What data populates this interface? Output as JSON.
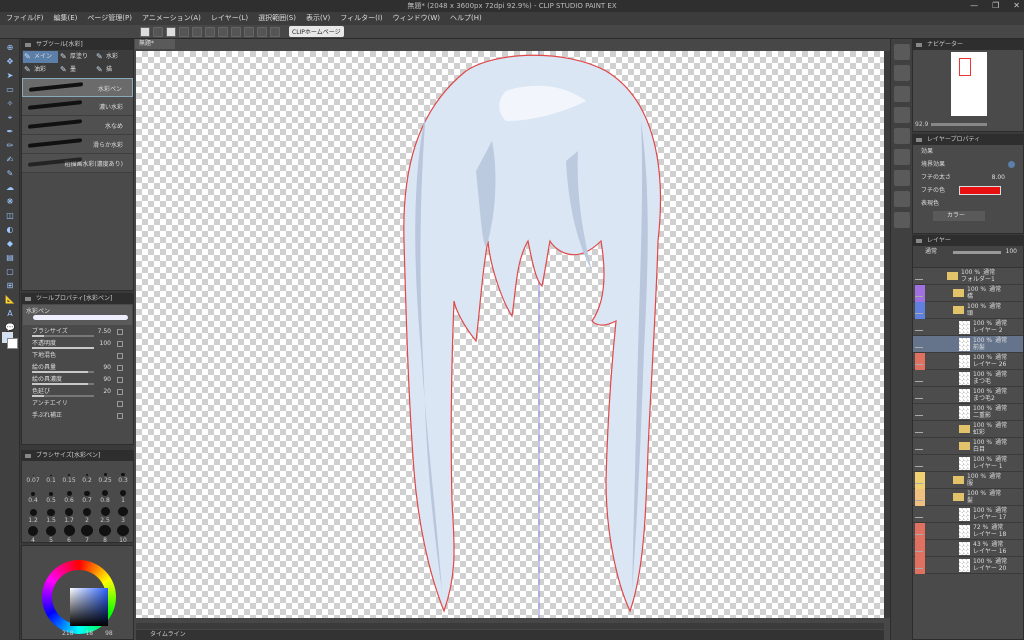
{
  "title": "無題* (2048 x 3600px 72dpi 92.9%) - CLIP STUDIO PAINT EX",
  "menu": [
    "ファイル(F)",
    "編集(E)",
    "ページ管理(P)",
    "アニメーション(A)",
    "レイヤー(L)",
    "選択範囲(S)",
    "表示(V)",
    "フィルター(I)",
    "ウィンドウ(W)",
    "ヘルプ(H)"
  ],
  "command_bar": {
    "home_label": "CLIPホームページ"
  },
  "doc_tab": "無題*",
  "subtool": {
    "header": "サブツール[水彩]",
    "tabs": [
      "メイン",
      "厚塗り",
      "水彩",
      "油彩",
      "墨",
      "描"
    ],
    "brushes": [
      "水彩ペン",
      "濃い水彩",
      "水なめ",
      "滑らか水彩",
      "粗描画水彩(濃度あり)"
    ]
  },
  "tool_property": {
    "header": "ツールプロパティ[水彩ペン]",
    "brush_name": "水彩ペン",
    "rows": [
      {
        "label": "ブラシサイズ",
        "value": "7.50",
        "fill": 0.2
      },
      {
        "label": "不透明度",
        "value": "100",
        "fill": 1.0
      },
      {
        "label": "下地混色",
        "value": "",
        "fill": 0
      },
      {
        "label": "絵の具量",
        "value": "90",
        "fill": 0.9
      },
      {
        "label": "絵の具濃度",
        "value": "90",
        "fill": 0.9
      },
      {
        "label": "色延び",
        "value": "20",
        "fill": 0.2
      },
      {
        "label": "アンチエイリ",
        "value": "",
        "fill": 0
      },
      {
        "label": "手ぶれ補正",
        "value": "",
        "fill": 0
      }
    ]
  },
  "brush_size": {
    "header": "ブラシサイズ[水彩ペン]",
    "sizes": [
      "0.07",
      "0.1",
      "0.15",
      "0.2",
      "0.25",
      "0.3",
      "0.4",
      "0.5",
      "0.6",
      "0.7",
      "0.8",
      "1",
      "1.2",
      "1.5",
      "1.7",
      "2",
      "2.5",
      "3",
      "4",
      "5",
      "6",
      "7",
      "8",
      "10"
    ]
  },
  "color_panel": {
    "bottom_values": [
      "218",
      "18",
      "98"
    ]
  },
  "navigator": {
    "header": "ナビゲーター",
    "zoom": "92.9"
  },
  "layer_property": {
    "header": "レイヤープロパティ",
    "section": "効果",
    "border_effect": "境界効果",
    "edge_width_label": "フチの太さ",
    "edge_width_value": "8.00",
    "edge_color_label": "フチの色",
    "edge_color": "#e81010",
    "expression_color_label": "表現色",
    "expression_color_value": "カラー"
  },
  "layers": {
    "header": "レイヤー",
    "blend_mode": "通常",
    "opacity": "100",
    "rows": [
      {
        "pct": "100 %",
        "mode": "通常",
        "name": "フォルダー1",
        "type": "folder",
        "tag": "",
        "indent": 1
      },
      {
        "pct": "100 %",
        "mode": "通常",
        "name": "橋",
        "type": "folder",
        "tag": "#a070e0",
        "indent": 2
      },
      {
        "pct": "100 %",
        "mode": "通常",
        "name": "頭",
        "type": "folder",
        "tag": "#6080e0",
        "indent": 2
      },
      {
        "pct": "100 %",
        "mode": "通常",
        "name": "レイヤー 2",
        "type": "layer",
        "tag": "",
        "indent": 3
      },
      {
        "pct": "100 %",
        "mode": "通常",
        "name": "前髪",
        "type": "layer",
        "tag": "",
        "indent": 3,
        "selected": true
      },
      {
        "pct": "100 %",
        "mode": "通常",
        "name": "レイヤー 26",
        "type": "layer",
        "tag": "#e07060",
        "indent": 3
      },
      {
        "pct": "100 %",
        "mode": "通常",
        "name": "まつ毛",
        "type": "layer",
        "tag": "",
        "indent": 3
      },
      {
        "pct": "100 %",
        "mode": "通常",
        "name": "まつ毛2",
        "type": "layer",
        "tag": "",
        "indent": 3
      },
      {
        "pct": "100 %",
        "mode": "通常",
        "name": "二重影",
        "type": "layer",
        "tag": "",
        "indent": 3
      },
      {
        "pct": "100 %",
        "mode": "通常",
        "name": "虹彩",
        "type": "folder",
        "tag": "",
        "indent": 3
      },
      {
        "pct": "100 %",
        "mode": "通常",
        "name": "白目",
        "type": "folder",
        "tag": "",
        "indent": 3
      },
      {
        "pct": "100 %",
        "mode": "通常",
        "name": "レイヤー 1",
        "type": "layer",
        "tag": "",
        "indent": 3
      },
      {
        "pct": "100 %",
        "mode": "通常",
        "name": "服",
        "type": "folder",
        "tag": "#f0d070",
        "indent": 2
      },
      {
        "pct": "100 %",
        "mode": "通常",
        "name": "髪",
        "type": "folder",
        "tag": "#f0c080",
        "indent": 2
      },
      {
        "pct": "100 %",
        "mode": "通常",
        "name": "レイヤー 17",
        "type": "layer",
        "tag": "",
        "indent": 3
      },
      {
        "pct": "72 %",
        "mode": "通常",
        "name": "レイヤー 18",
        "type": "layer",
        "tag": "#e07060",
        "indent": 3
      },
      {
        "pct": "43 %",
        "mode": "通常",
        "name": "レイヤー 16",
        "type": "layer",
        "tag": "#e07060",
        "indent": 3
      },
      {
        "pct": "100 %",
        "mode": "通常",
        "name": "レイヤー 20",
        "type": "layer",
        "tag": "#e07060",
        "indent": 3
      }
    ]
  },
  "timeline_label": "タイムライン",
  "colors": {
    "accent": "#5b7fa8",
    "hair": "#dbe6f5",
    "outline": "#e04848"
  }
}
